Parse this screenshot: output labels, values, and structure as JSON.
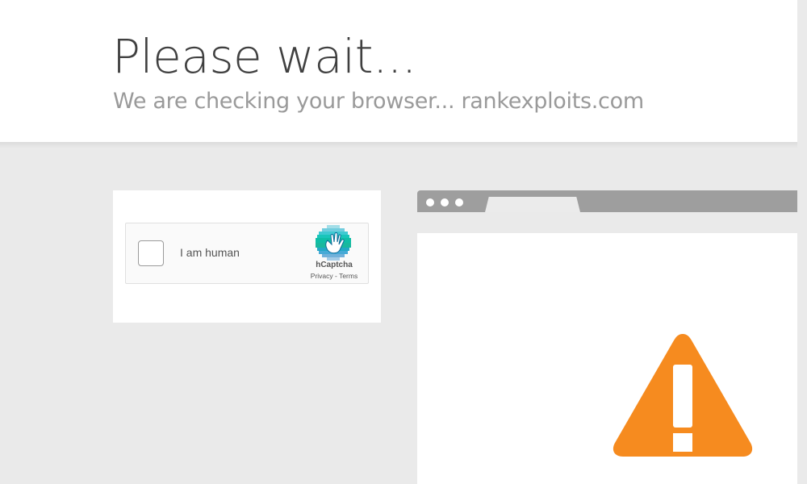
{
  "header": {
    "title": "Please wait...",
    "subtitle": "We are checking your browser... rankexploits.com"
  },
  "captcha": {
    "checkbox_label": "I am human",
    "brand": "hCaptcha",
    "privacy_link": "Privacy",
    "separator": " - ",
    "terms_link": "Terms",
    "checked": false
  },
  "browser_illustration": {
    "warning_icon": "warning-triangle-icon",
    "warning_color": "#f68b1f"
  },
  "colors": {
    "background": "#eaeaea",
    "header_background": "#ffffff",
    "title": "#404040",
    "subtitle": "#9a9a9a",
    "hcaptcha_teal": "#0074bf"
  }
}
